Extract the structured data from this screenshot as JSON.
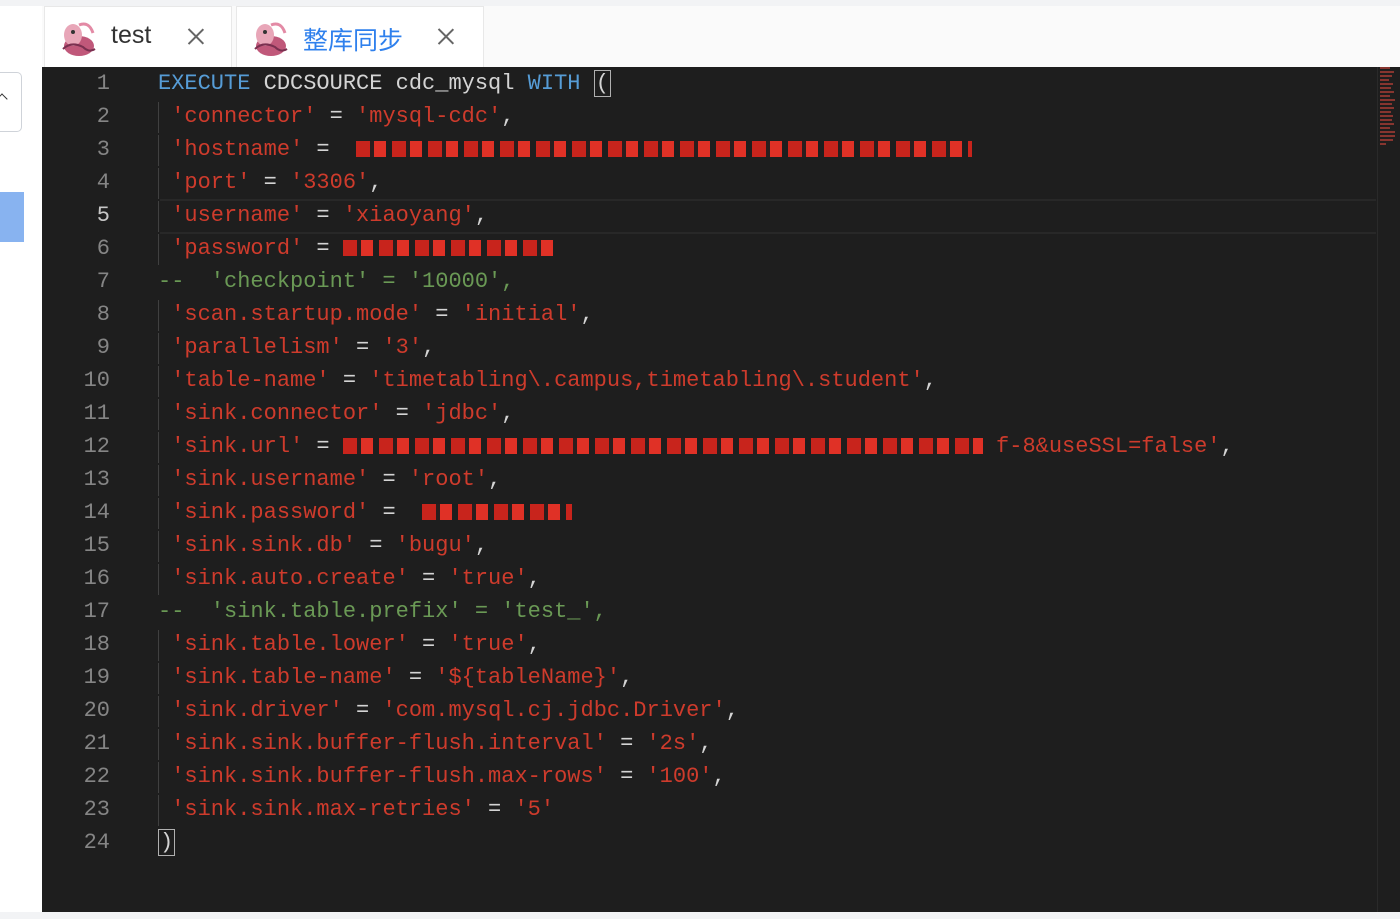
{
  "tabs": [
    {
      "label": "test",
      "icon": "flink-squirrel-icon",
      "active": false
    },
    {
      "label": "整库同步",
      "icon": "flink-squirrel-icon",
      "active": true
    }
  ],
  "editor": {
    "active_line": 5,
    "line_numbers": [
      "1",
      "2",
      "3",
      "4",
      "5",
      "6",
      "7",
      "8",
      "9",
      "10",
      "11",
      "12",
      "13",
      "14",
      "15",
      "16",
      "17",
      "18",
      "19",
      "20",
      "21",
      "22",
      "23",
      "24"
    ],
    "lines": [
      [
        {
          "t": "kw",
          "v": "EXECUTE"
        },
        {
          "t": "op",
          "v": " CDCSOURCE cdc_mysql "
        },
        {
          "t": "kw",
          "v": "WITH"
        },
        {
          "t": "op",
          "v": " "
        },
        {
          "t": "bracket",
          "v": "("
        }
      ],
      [
        {
          "t": "op",
          "v": " "
        },
        {
          "t": "str",
          "v": "'connector'"
        },
        {
          "t": "op",
          "v": " = "
        },
        {
          "t": "str",
          "v": "'mysql-cdc'"
        },
        {
          "t": "op",
          "v": ","
        }
      ],
      [
        {
          "t": "op",
          "v": " "
        },
        {
          "t": "str",
          "v": "'hostname'"
        },
        {
          "t": "op",
          "v": " =  "
        },
        {
          "t": "redact",
          "v": "616"
        }
      ],
      [
        {
          "t": "op",
          "v": " "
        },
        {
          "t": "str",
          "v": "'port'"
        },
        {
          "t": "op",
          "v": " = "
        },
        {
          "t": "str",
          "v": "'3306'"
        },
        {
          "t": "op",
          "v": ","
        }
      ],
      [
        {
          "t": "op",
          "v": " "
        },
        {
          "t": "str",
          "v": "'username'"
        },
        {
          "t": "op",
          "v": " = "
        },
        {
          "t": "str",
          "v": "'xiaoyang'"
        },
        {
          "t": "op",
          "v": ","
        }
      ],
      [
        {
          "t": "op",
          "v": " "
        },
        {
          "t": "str",
          "v": "'password'"
        },
        {
          "t": "op",
          "v": " = "
        },
        {
          "t": "redact",
          "v": "212"
        }
      ],
      [
        {
          "t": "cm",
          "v": "--  'checkpoint' = '10000',"
        }
      ],
      [
        {
          "t": "op",
          "v": " "
        },
        {
          "t": "str",
          "v": "'scan.startup.mode'"
        },
        {
          "t": "op",
          "v": " = "
        },
        {
          "t": "str",
          "v": "'initial'"
        },
        {
          "t": "op",
          "v": ","
        }
      ],
      [
        {
          "t": "op",
          "v": " "
        },
        {
          "t": "str",
          "v": "'parallelism'"
        },
        {
          "t": "op",
          "v": " = "
        },
        {
          "t": "str",
          "v": "'3'"
        },
        {
          "t": "op",
          "v": ","
        }
      ],
      [
        {
          "t": "op",
          "v": " "
        },
        {
          "t": "str",
          "v": "'table-name'"
        },
        {
          "t": "op",
          "v": " = "
        },
        {
          "t": "str",
          "v": "'timetabling\\.campus,timetabling\\.student'"
        },
        {
          "t": "op",
          "v": ","
        }
      ],
      [
        {
          "t": "op",
          "v": " "
        },
        {
          "t": "str",
          "v": "'sink.connector'"
        },
        {
          "t": "op",
          "v": " = "
        },
        {
          "t": "str",
          "v": "'jdbc'"
        },
        {
          "t": "op",
          "v": ","
        }
      ],
      [
        {
          "t": "op",
          "v": " "
        },
        {
          "t": "str",
          "v": "'sink.url'"
        },
        {
          "t": "op",
          "v": " = "
        },
        {
          "t": "redact",
          "v": "640"
        },
        {
          "t": "str",
          "v": " f-8&useSSL=false'"
        },
        {
          "t": "op",
          "v": ","
        }
      ],
      [
        {
          "t": "op",
          "v": " "
        },
        {
          "t": "str",
          "v": "'sink.username'"
        },
        {
          "t": "op",
          "v": " = "
        },
        {
          "t": "str",
          "v": "'root'"
        },
        {
          "t": "op",
          "v": ","
        }
      ],
      [
        {
          "t": "op",
          "v": " "
        },
        {
          "t": "str",
          "v": "'sink.password'"
        },
        {
          "t": "op",
          "v": " =  "
        },
        {
          "t": "redact",
          "v": "150"
        }
      ],
      [
        {
          "t": "op",
          "v": " "
        },
        {
          "t": "str",
          "v": "'sink.sink.db'"
        },
        {
          "t": "op",
          "v": " = "
        },
        {
          "t": "str",
          "v": "'bugu'"
        },
        {
          "t": "op",
          "v": ","
        }
      ],
      [
        {
          "t": "op",
          "v": " "
        },
        {
          "t": "str",
          "v": "'sink.auto.create'"
        },
        {
          "t": "op",
          "v": " = "
        },
        {
          "t": "str",
          "v": "'true'"
        },
        {
          "t": "op",
          "v": ","
        }
      ],
      [
        {
          "t": "cm",
          "v": "--  'sink.table.prefix' = 'test_',"
        }
      ],
      [
        {
          "t": "op",
          "v": " "
        },
        {
          "t": "str",
          "v": "'sink.table.lower'"
        },
        {
          "t": "op",
          "v": " = "
        },
        {
          "t": "str",
          "v": "'true'"
        },
        {
          "t": "op",
          "v": ","
        }
      ],
      [
        {
          "t": "op",
          "v": " "
        },
        {
          "t": "str",
          "v": "'sink.table-name'"
        },
        {
          "t": "op",
          "v": " = "
        },
        {
          "t": "str",
          "v": "'${tableName}'"
        },
        {
          "t": "op",
          "v": ","
        }
      ],
      [
        {
          "t": "op",
          "v": " "
        },
        {
          "t": "str",
          "v": "'sink.driver'"
        },
        {
          "t": "op",
          "v": " = "
        },
        {
          "t": "str",
          "v": "'com.mysql.cj.jdbc.Driver'"
        },
        {
          "t": "op",
          "v": ","
        }
      ],
      [
        {
          "t": "op",
          "v": " "
        },
        {
          "t": "str",
          "v": "'sink.sink.buffer-flush.interval'"
        },
        {
          "t": "op",
          "v": " = "
        },
        {
          "t": "str",
          "v": "'2s'"
        },
        {
          "t": "op",
          "v": ","
        }
      ],
      [
        {
          "t": "op",
          "v": " "
        },
        {
          "t": "str",
          "v": "'sink.sink.buffer-flush.max-rows'"
        },
        {
          "t": "op",
          "v": " = "
        },
        {
          "t": "str",
          "v": "'100'"
        },
        {
          "t": "op",
          "v": ","
        }
      ],
      [
        {
          "t": "op",
          "v": " "
        },
        {
          "t": "str",
          "v": "'sink.sink.max-retries'"
        },
        {
          "t": "op",
          "v": " = "
        },
        {
          "t": "str",
          "v": "'5'"
        }
      ],
      [
        {
          "t": "bracket",
          "v": ")"
        }
      ]
    ]
  },
  "colors": {
    "keyword": "#569cd6",
    "string": "#ce3b2c",
    "comment": "#6a9955",
    "editor_bg": "#1e1e1e",
    "active_tab_text": "#2f80ed"
  }
}
